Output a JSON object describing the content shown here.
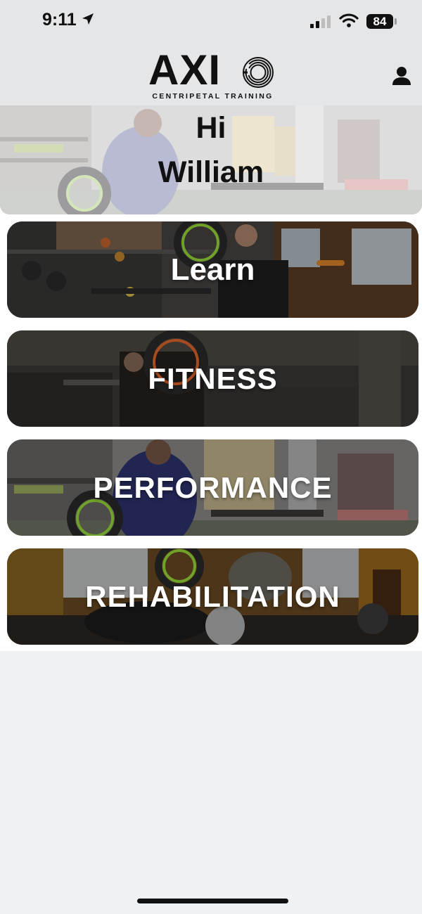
{
  "status_bar": {
    "time": "9:11",
    "battery": "84"
  },
  "header": {
    "logo_text": "AXI",
    "logo_tagline": "CENTRIPETAL TRAINING",
    "profile_icon": "person-icon"
  },
  "greeting": {
    "hi": "Hi",
    "name": "William"
  },
  "menu": {
    "items": [
      {
        "label": "Learn"
      },
      {
        "label": "FITNESS"
      },
      {
        "label": "PERFORMANCE"
      },
      {
        "label": "REHABILITATION"
      }
    ]
  },
  "colors": {
    "accent_green": "#9be03a",
    "ring_orange": "#e9692c",
    "header_bg": "#e4e6e8",
    "page_bg": "#eff2f5"
  }
}
